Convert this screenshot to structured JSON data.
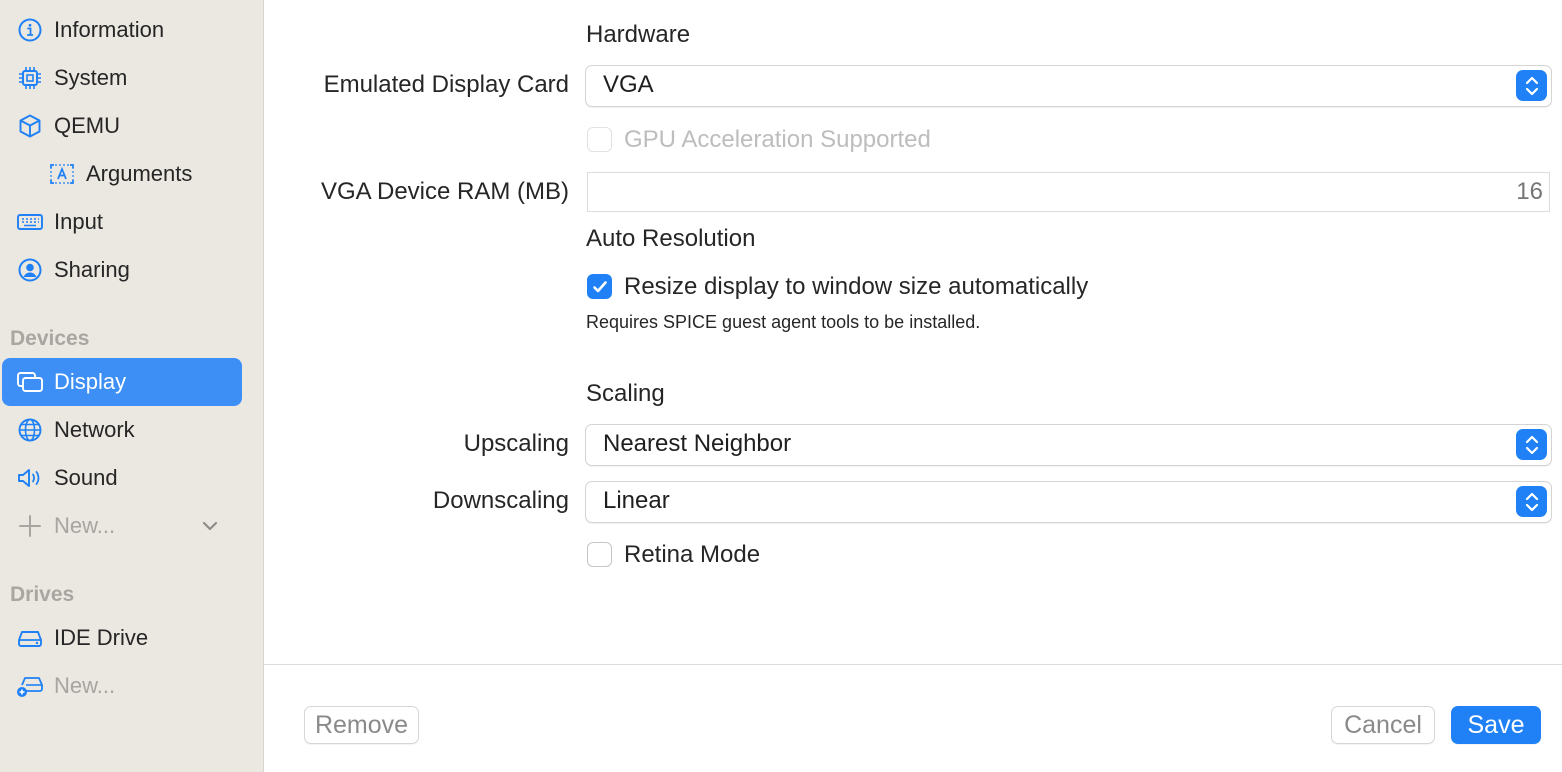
{
  "sidebar": {
    "items": [
      {
        "label": "Information",
        "icon": "info-icon"
      },
      {
        "label": "System",
        "icon": "cpu-icon"
      },
      {
        "label": "QEMU",
        "icon": "cube-icon"
      },
      {
        "label": "Arguments",
        "icon": "arguments-icon"
      },
      {
        "label": "Input",
        "icon": "keyboard-icon"
      },
      {
        "label": "Sharing",
        "icon": "person-circle-icon"
      }
    ],
    "devices_header": "Devices",
    "devices": [
      {
        "label": "Display",
        "icon": "display-icon",
        "selected": true
      },
      {
        "label": "Network",
        "icon": "globe-icon"
      },
      {
        "label": "Sound",
        "icon": "speaker-icon"
      },
      {
        "label": "New...",
        "icon": "plus-icon"
      }
    ],
    "drives_header": "Drives",
    "drives": [
      {
        "label": "IDE Drive",
        "icon": "drive-icon"
      },
      {
        "label": "New...",
        "icon": "add-drive-icon"
      }
    ]
  },
  "main": {
    "hardware_heading": "Hardware",
    "display_card_label": "Emulated Display Card",
    "display_card_value": "VGA",
    "gpu_accel_label": "GPU Acceleration Supported",
    "gpu_accel_checked": false,
    "vga_ram_label": "VGA Device RAM (MB)",
    "vga_ram_placeholder": "16",
    "auto_res_heading": "Auto Resolution",
    "resize_label": "Resize display to window size automatically",
    "resize_checked": true,
    "resize_note": "Requires SPICE guest agent tools to be installed.",
    "scaling_heading": "Scaling",
    "upscaling_label": "Upscaling",
    "upscaling_value": "Nearest Neighbor",
    "downscaling_label": "Downscaling",
    "downscaling_value": "Linear",
    "retina_label": "Retina Mode",
    "retina_checked": false
  },
  "footer": {
    "remove_label": "Remove",
    "cancel_label": "Cancel",
    "save_label": "Save"
  },
  "colors": {
    "accent": "#1f81f5",
    "sidebar_selected": "#3d8ff5",
    "sidebar_bg": "#ebe7e1"
  }
}
